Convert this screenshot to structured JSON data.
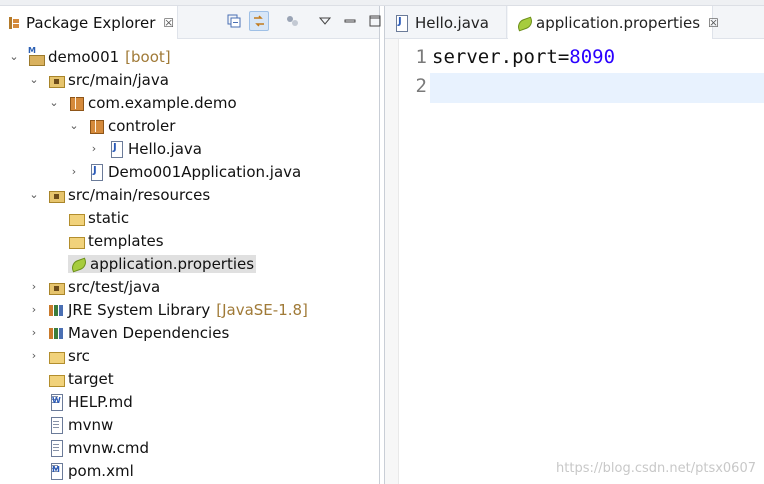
{
  "package_explorer": {
    "tab_title": "Package Explorer",
    "tab_close": "☒",
    "toolbar_icons": [
      "collapse-all-icon",
      "link-with-editor-icon",
      "focus-icon",
      "view-menu-icon",
      "minimize-icon",
      "maximize-icon"
    ],
    "tree": [
      {
        "label": "demo001",
        "decoration": "[boot]"
      },
      {
        "label": "src/main/java"
      },
      {
        "label": "com.example.demo"
      },
      {
        "label": "controler"
      },
      {
        "label": "Hello.java"
      },
      {
        "label": "Demo001Application.java"
      },
      {
        "label": "src/main/resources"
      },
      {
        "label": "static"
      },
      {
        "label": "templates"
      },
      {
        "label": "application.properties"
      },
      {
        "label": "src/test/java"
      },
      {
        "label": "JRE System Library",
        "decoration": "[JavaSE-1.8]"
      },
      {
        "label": "Maven Dependencies"
      },
      {
        "label": "src"
      },
      {
        "label": "target"
      },
      {
        "label": "HELP.md"
      },
      {
        "label": "mvnw"
      },
      {
        "label": "mvnw.cmd"
      },
      {
        "label": "pom.xml"
      }
    ]
  },
  "editor": {
    "tabs": [
      {
        "label": "Hello.java"
      },
      {
        "label": "application.properties",
        "close": "☒"
      }
    ],
    "lines": [
      {
        "number": "1",
        "key": "server.port=",
        "value": "8090"
      },
      {
        "number": "2",
        "key": "",
        "value": ""
      }
    ]
  },
  "watermark": "https://blog.csdn.net/ptsx0607"
}
